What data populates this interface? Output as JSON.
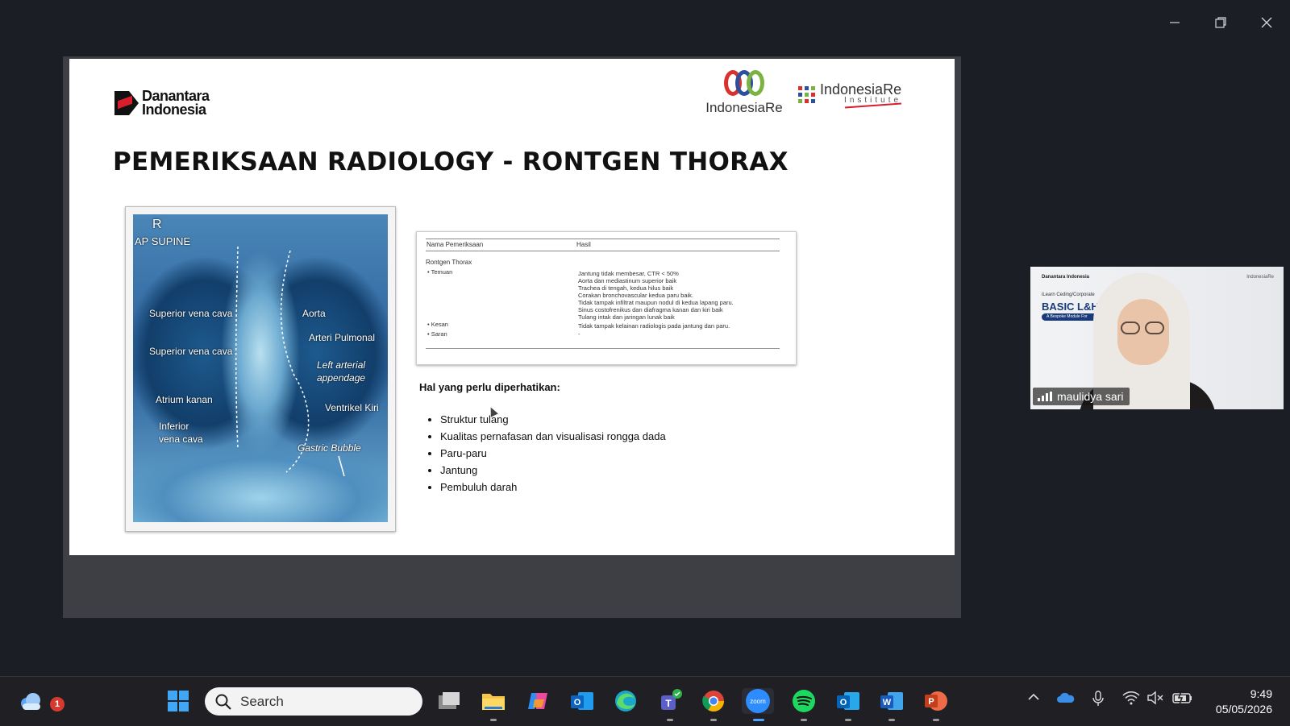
{
  "window": {
    "minimize_icon": "minimize-icon",
    "restore_icon": "restore-icon",
    "close_icon": "close-icon"
  },
  "slide": {
    "logo_left_line1": "Danantara",
    "logo_left_line2": "Indonesia",
    "logo_ire": "IndonesiaRe",
    "logo_iri_name": "IndonesiaRe",
    "logo_iri_sub": "Institute",
    "title": "PEMERIKSAAN RADIOLOGY - RONTGEN THORAX",
    "xray_labels": {
      "r": "R",
      "ap": "AP SUPINE",
      "svc1": "Superior vena cava",
      "svc2": "Superior vena cava",
      "aorta": "Aorta",
      "arteri": "Arteri Pulmonal",
      "left_arterial_1": "Left arterial",
      "left_arterial_2": "appendage",
      "atrium": "Atrium kanan",
      "ventrikel": "Ventrikel Kiri",
      "ivc1": "Inferior",
      "ivc2": "vena cava",
      "gastric": "Gastric Bubble"
    },
    "report": {
      "col1": "Nama Pemeriksaan",
      "col2": "Hasil",
      "exam": "Rontgen Thorax",
      "temuan": "• Temuan",
      "findings": [
        "Jantung tidak membesar, CTR < 50%",
        "Aorta dan mediastinum superior baik",
        "Trachea di tengah, kedua hilus baik",
        "Corakan bronchovascular kedua paru baik.",
        "Tidak tampak infiltrat maupun nodul di kedua lapang paru.",
        "Sinus costofrenikus dan diafragma kanan dan kiri baik",
        "Tulang intak dan jaringan lunak baik"
      ],
      "kesan": "• Kesan",
      "kesan_value": "Tidak tampak kelainan radiologis pada jantung dan paru.",
      "saran": "• Saran",
      "saran_value": "-"
    },
    "notes_title": "Hal yang perlu diperhatikan:",
    "notes": [
      "Struktur tulang",
      "Kualitas pernafasan dan visualisasi rongga dada",
      "Paru-paru",
      "Jantung",
      "Pembuluh darah"
    ]
  },
  "video": {
    "participant": "maulidya sari",
    "bg_logo_left": "Danantara Indonesia",
    "bg_logo_right": "IndonesiaRe",
    "bg_small": "iLearn Ceding/Corporate",
    "bg_big": "BASIC L&H",
    "bg_pill": "A Bespoke Module For"
  },
  "taskbar": {
    "weather_badge": "1",
    "search_placeholder": "Search",
    "zoom_label": "zoom",
    "clock_time": "9:49",
    "clock_date": "05/05/2026"
  }
}
